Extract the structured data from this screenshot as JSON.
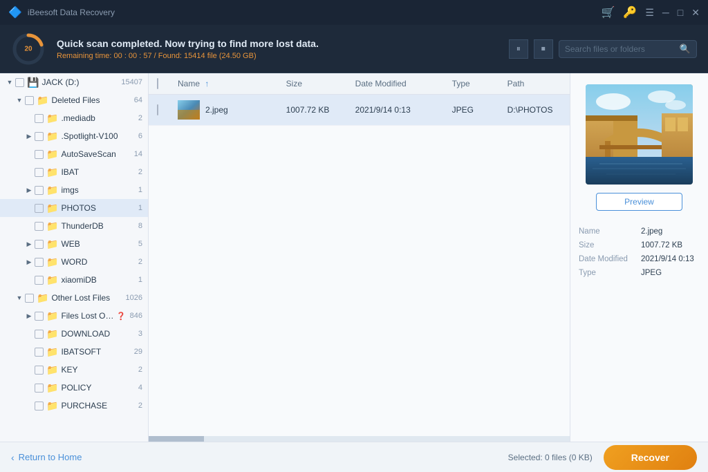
{
  "titlebar": {
    "title": "iBeesoft Data Recovery",
    "controls": [
      "cart-icon",
      "key-icon",
      "menu-icon",
      "minimize-icon",
      "maximize-icon",
      "close-icon"
    ]
  },
  "header": {
    "progress": 20,
    "title": "Quick scan completed. Now trying to find more lost data.",
    "subtitle_prefix": "Remaining time: 00 : 00 : 57 / Found: 15414 file ",
    "subtitle_size": "(24.50 GB)",
    "search_placeholder": "Search files or folders"
  },
  "sidebar": {
    "items": [
      {
        "id": "jack-drive",
        "label": "JACK (D:)",
        "count": "15407",
        "level": 0,
        "type": "drive",
        "arrow": "open",
        "checked": false
      },
      {
        "id": "deleted-files",
        "label": "Deleted Files",
        "count": "64",
        "level": 1,
        "type": "folder-red",
        "arrow": "open",
        "checked": false
      },
      {
        "id": "mediadb",
        "label": ".mediadb",
        "count": "2",
        "level": 2,
        "type": "folder-gray",
        "arrow": "none",
        "checked": false
      },
      {
        "id": "spotlight",
        "label": ".Spotlight-V100",
        "count": "6",
        "level": 2,
        "type": "folder-gray",
        "arrow": "closed",
        "checked": false
      },
      {
        "id": "autosavescan",
        "label": "AutoSaveScan",
        "count": "14",
        "level": 2,
        "type": "folder-yellow",
        "arrow": "none",
        "checked": false
      },
      {
        "id": "ibat",
        "label": "IBAT",
        "count": "2",
        "level": 2,
        "type": "folder-yellow",
        "arrow": "none",
        "checked": false
      },
      {
        "id": "imgs",
        "label": "imgs",
        "count": "1",
        "level": 2,
        "type": "folder-yellow",
        "arrow": "closed",
        "checked": false
      },
      {
        "id": "photos",
        "label": "PHOTOS",
        "count": "1",
        "level": 2,
        "type": "folder-yellow",
        "arrow": "none",
        "checked": false,
        "selected": true
      },
      {
        "id": "thunderdb",
        "label": "ThunderDB",
        "count": "8",
        "level": 2,
        "type": "folder-yellow",
        "arrow": "none",
        "checked": false
      },
      {
        "id": "web",
        "label": "WEB",
        "count": "5",
        "level": 2,
        "type": "folder-yellow",
        "arrow": "closed",
        "checked": false
      },
      {
        "id": "word",
        "label": "WORD",
        "count": "2",
        "level": 2,
        "type": "folder-yellow",
        "arrow": "closed",
        "checked": false
      },
      {
        "id": "xiaomidb",
        "label": "xiaomiDB",
        "count": "1",
        "level": 2,
        "type": "folder-yellow",
        "arrow": "none",
        "checked": false
      },
      {
        "id": "other-lost",
        "label": "Other Lost Files",
        "count": "1026",
        "level": 1,
        "type": "folder-red",
        "arrow": "open",
        "checked": false
      },
      {
        "id": "files-lost-origin",
        "label": "Files Lost Origin...",
        "count": "846",
        "level": 2,
        "type": "folder-yellow",
        "arrow": "closed",
        "checked": false,
        "has_help": true
      },
      {
        "id": "download",
        "label": "DOWNLOAD",
        "count": "3",
        "level": 2,
        "type": "folder-yellow",
        "arrow": "none",
        "checked": false
      },
      {
        "id": "ibatsoft",
        "label": "IBATSOFT",
        "count": "29",
        "level": 2,
        "type": "folder-yellow",
        "arrow": "none",
        "checked": false
      },
      {
        "id": "key",
        "label": "KEY",
        "count": "2",
        "level": 2,
        "type": "folder-yellow",
        "arrow": "none",
        "checked": false
      },
      {
        "id": "policy",
        "label": "POLICY",
        "count": "4",
        "level": 2,
        "type": "folder-yellow",
        "arrow": "none",
        "checked": false
      },
      {
        "id": "purchase",
        "label": "PURCHASE",
        "count": "2",
        "level": 2,
        "type": "folder-yellow",
        "arrow": "none",
        "checked": false
      }
    ]
  },
  "table": {
    "columns": [
      "Name",
      "Size",
      "Date Modified",
      "Type",
      "Path"
    ],
    "rows": [
      {
        "id": 1,
        "name": "2.jpeg",
        "size": "1007.72 KB",
        "date": "2021/9/14 0:13",
        "type": "JPEG",
        "path": "D:\\PHOTOS",
        "checked": false
      }
    ]
  },
  "preview": {
    "button_label": "Preview",
    "file_info": {
      "name_label": "Name",
      "name_value": "2.jpeg",
      "size_label": "Size",
      "size_value": "1007.72 KB",
      "date_label": "Date Modified",
      "date_value": "2021/9/14 0:13",
      "type_label": "Type",
      "type_value": "JPEG"
    }
  },
  "bottom": {
    "back_label": "Return to Home",
    "selected_label": "Selected: 0 files (0 KB)",
    "recover_label": "Recover"
  }
}
